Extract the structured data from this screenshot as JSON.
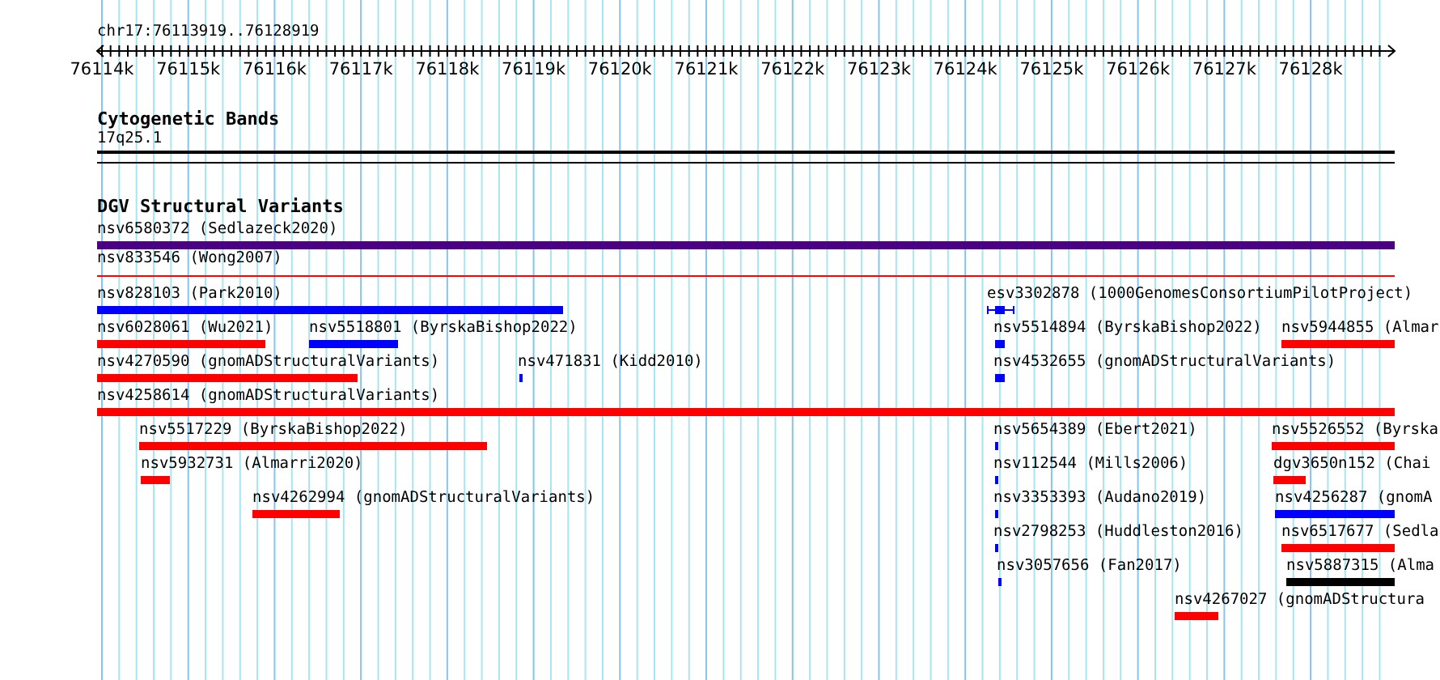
{
  "ruler": {
    "region": "chr17:76113919..76128919",
    "ticks": [
      "76114k",
      "76115k",
      "76116k",
      "76117k",
      "76118k",
      "76119k",
      "76120k",
      "76121k",
      "76122k",
      "76123k",
      "76124k",
      "76125k",
      "76126k",
      "76127k",
      "76128k"
    ]
  },
  "cytogenetic_bands": {
    "title": "Cytogenetic Bands",
    "band": "17q25.1"
  },
  "dgv_structural_variants": {
    "title": "DGV Structural Variants",
    "features": [
      {
        "label": "nsv6580372 (Sedlazeck2020)",
        "color": "#4b0082",
        "kind": "bar"
      },
      {
        "label": "nsv833546 (Wong2007)",
        "color": "#ff0000",
        "kind": "line"
      },
      {
        "label": "nsv828103 (Park2010)",
        "color": "#0000ff",
        "kind": "bar"
      },
      {
        "label": "esv3302878 (1000GenomesConsortiumPilotProject)",
        "color": "#0000ff",
        "kind": "whisker"
      },
      {
        "label": "nsv6028061 (Wu2021)",
        "color": "#ff0000",
        "kind": "bar"
      },
      {
        "label": "nsv5518801 (ByrskaBishop2022)",
        "color": "#0000ff",
        "kind": "bar"
      },
      {
        "label": "nsv5514894 (ByrskaBishop2022)",
        "color": "#0000ff",
        "kind": "bar"
      },
      {
        "label": "nsv5944855 (Almar",
        "color": "#ff0000",
        "kind": "bar"
      },
      {
        "label": "nsv4270590 (gnomADStructuralVariants)",
        "color": "#ff0000",
        "kind": "bar"
      },
      {
        "label": "nsv471831 (Kidd2010)",
        "color": "#0000ff",
        "kind": "bar"
      },
      {
        "label": "nsv4532655 (gnomADStructuralVariants)",
        "color": "#0000ff",
        "kind": "bar"
      },
      {
        "label": "nsv4258614 (gnomADStructuralVariants)",
        "color": "#ff0000",
        "kind": "bar"
      },
      {
        "label": "nsv5517229 (ByrskaBishop2022)",
        "color": "#ff0000",
        "kind": "bar"
      },
      {
        "label": "nsv5654389 (Ebert2021)",
        "color": "#0000ff",
        "kind": "bar"
      },
      {
        "label": "nsv5526552 (Byrska",
        "color": "#ff0000",
        "kind": "bar"
      },
      {
        "label": "nsv5932731 (Almarri2020)",
        "color": "#ff0000",
        "kind": "bar"
      },
      {
        "label": "nsv112544 (Mills2006)",
        "color": "#0000ff",
        "kind": "bar"
      },
      {
        "label": "dgv3650n152 (Chai",
        "color": "#ff0000",
        "kind": "bar"
      },
      {
        "label": "nsv4262994 (gnomADStructuralVariants)",
        "color": "#ff0000",
        "kind": "bar"
      },
      {
        "label": "nsv3353393 (Audano2019)",
        "color": "#0000ff",
        "kind": "bar"
      },
      {
        "label": "nsv4256287 (gnomA",
        "color": "#0000ff",
        "kind": "bar"
      },
      {
        "label": "nsv2798253 (Huddleston2016)",
        "color": "#0000ff",
        "kind": "bar"
      },
      {
        "label": "nsv6517677 (Sedla",
        "color": "#ff0000",
        "kind": "bar"
      },
      {
        "label": "nsv3057656 (Fan2017)",
        "color": "#0000ff",
        "kind": "bar"
      },
      {
        "label": "nsv5887315 (Alma",
        "color": "#000000",
        "kind": "bar"
      },
      {
        "label": "nsv4267027 (gnomADStructura",
        "color": "#ff0000",
        "kind": "bar"
      }
    ]
  }
}
